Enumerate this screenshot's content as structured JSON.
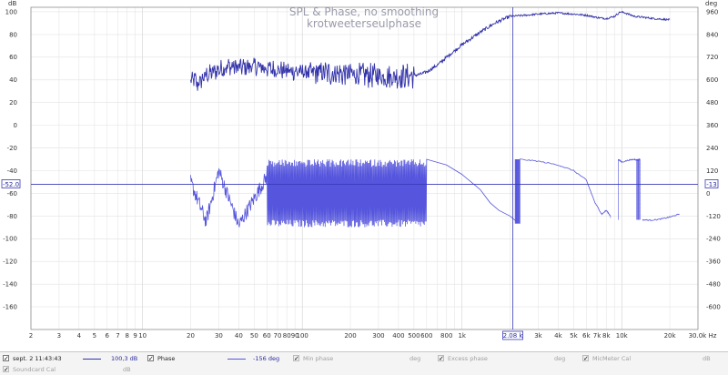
{
  "chart_data": {
    "type": "line",
    "title": "SPL & Phase, no smoothing",
    "subtitle": "krotweeterseulphase",
    "x_scale": "log",
    "xlim": [
      2,
      30000
    ],
    "x_ticks": [
      {
        "v": 2,
        "label": "2"
      },
      {
        "v": 3,
        "label": "3"
      },
      {
        "v": 4,
        "label": "4"
      },
      {
        "v": 5,
        "label": "5"
      },
      {
        "v": 6,
        "label": "6"
      },
      {
        "v": 7,
        "label": "7"
      },
      {
        "v": 8,
        "label": "8"
      },
      {
        "v": 9,
        "label": "9"
      },
      {
        "v": 10,
        "label": "10"
      },
      {
        "v": 20,
        "label": "20"
      },
      {
        "v": 30,
        "label": "30"
      },
      {
        "v": 40,
        "label": "40"
      },
      {
        "v": 50,
        "label": "50"
      },
      {
        "v": 60,
        "label": "60"
      },
      {
        "v": 70,
        "label": "70"
      },
      {
        "v": 80,
        "label": "80"
      },
      {
        "v": 90,
        "label": "90"
      },
      {
        "v": 100,
        "label": "100"
      },
      {
        "v": 200,
        "label": "200"
      },
      {
        "v": 300,
        "label": "300"
      },
      {
        "v": 400,
        "label": "400"
      },
      {
        "v": 500,
        "label": "500"
      },
      {
        "v": 600,
        "label": "600"
      },
      {
        "v": 800,
        "label": "800"
      },
      {
        "v": 1000,
        "label": "1k"
      },
      {
        "v": 3000,
        "label": "3k"
      },
      {
        "v": 4000,
        "label": "4k"
      },
      {
        "v": 5000,
        "label": "5k"
      },
      {
        "v": 6000,
        "label": "6k"
      },
      {
        "v": 7000,
        "label": "7k"
      },
      {
        "v": 8000,
        "label": "8k"
      },
      {
        "v": 10000,
        "label": "10k"
      },
      {
        "v": 20000,
        "label": "20k"
      },
      {
        "v": 30000,
        "label": "30.0k Hz"
      }
    ],
    "left_axis": {
      "unit": "dB",
      "ylim": [
        -180,
        104
      ],
      "ticks": [
        100,
        80,
        60,
        40,
        20,
        0,
        -20,
        -40,
        -60,
        -80,
        -100,
        -120,
        -140,
        -160
      ],
      "tick_labels": [
        "100",
        "80",
        "60",
        "40",
        "20",
        "0",
        "-20",
        "-40",
        "-60",
        "-80",
        "-100",
        "-120",
        "-140",
        "-160"
      ]
    },
    "right_axis": {
      "unit": "deg",
      "ylim": [
        -720,
        984
      ],
      "ticks": [
        960,
        840,
        720,
        600,
        480,
        360,
        240,
        120,
        0,
        -120,
        -240,
        -360,
        -480,
        -600
      ],
      "tick_labels": [
        "960",
        "840",
        "720",
        "600",
        "480",
        "360",
        "240",
        "120",
        "0",
        "-120",
        "-240",
        "-360",
        "-480",
        "-600"
      ]
    },
    "grid": true,
    "cursor": {
      "x": 2080,
      "x_label": "2.08 k",
      "y_left": -52.0,
      "y_label": "-52.0",
      "y_right_label": "-13"
    },
    "series": [
      {
        "name": "sept. 2 11:43:43",
        "axis": "left",
        "color": "#3333aa",
        "noise_to": 500,
        "x": [
          20,
          21,
          22,
          25,
          30,
          35,
          40,
          50,
          60,
          70,
          80,
          100,
          150,
          200,
          250,
          300,
          350,
          400,
          450,
          500,
          550,
          600,
          700,
          800,
          1000,
          1300,
          1600,
          2000,
          2500,
          3000,
          4000,
          5000,
          6000,
          7000,
          8000,
          9000,
          9800,
          10500,
          12000,
          14000,
          16000,
          20000
        ],
        "y": [
          38,
          41,
          36,
          44,
          49,
          52,
          51,
          52,
          50,
          49,
          48,
          47,
          46,
          45,
          44,
          44,
          43,
          43,
          43,
          44,
          45,
          47,
          53,
          60,
          71,
          82,
          90,
          96,
          97,
          98,
          99,
          98,
          97,
          95,
          94,
          96,
          100,
          99,
          96,
          95,
          94,
          93
        ]
      },
      {
        "name": "Phase",
        "axis": "right",
        "color": "#5555dd",
        "wrap_to": 600,
        "wrap_range": [
          -180,
          180
        ],
        "x": [
          20,
          25,
          30,
          40,
          60,
          80,
          100,
          150,
          200,
          300,
          400,
          500,
          600,
          800,
          1000,
          1300,
          1500,
          1700,
          2000,
          2200
        ],
        "y": [
          60,
          -150,
          120,
          -170,
          90,
          -100,
          40,
          -160,
          150,
          -120,
          170,
          -90,
          180,
          150,
          100,
          20,
          -50,
          -90,
          -120,
          -150
        ],
        "segments": [
          {
            "x": [
              2300,
              3000,
              4000,
              5000,
              6000,
              6800,
              7500,
              8000,
              8500
            ],
            "y": [
              180,
              170,
              150,
              120,
              70,
              -50,
              -110,
              -90,
              -120
            ]
          },
          {
            "x": [
              9500,
              10000,
              11000,
              12000,
              12500,
              13000
            ],
            "y": [
              180,
              165,
              175,
              180,
              175,
              180
            ]
          },
          {
            "x": [
              13500,
              15000,
              17000,
              19000,
              21000,
              23000
            ],
            "y": [
              -140,
              -142,
              -138,
              -130,
              -120,
              -110
            ]
          }
        ]
      }
    ]
  },
  "legend": {
    "row1": [
      {
        "label": "sept. 2 11:43:43",
        "value": "100,3 dB",
        "checked": true,
        "enabled": true
      },
      {
        "label": "Phase",
        "value": "-156 deg",
        "checked": true,
        "enabled": true
      },
      {
        "label": "Min phase",
        "value": "deg",
        "checked": true,
        "enabled": false
      },
      {
        "label": "Excess phase",
        "value": "deg",
        "checked": true,
        "enabled": false
      },
      {
        "label": "MicMeter Cal",
        "value": "dB",
        "checked": true,
        "enabled": false
      }
    ],
    "row2": [
      {
        "label": "Soundcard Cal",
        "value": "dB",
        "checked": true,
        "enabled": false
      }
    ]
  }
}
